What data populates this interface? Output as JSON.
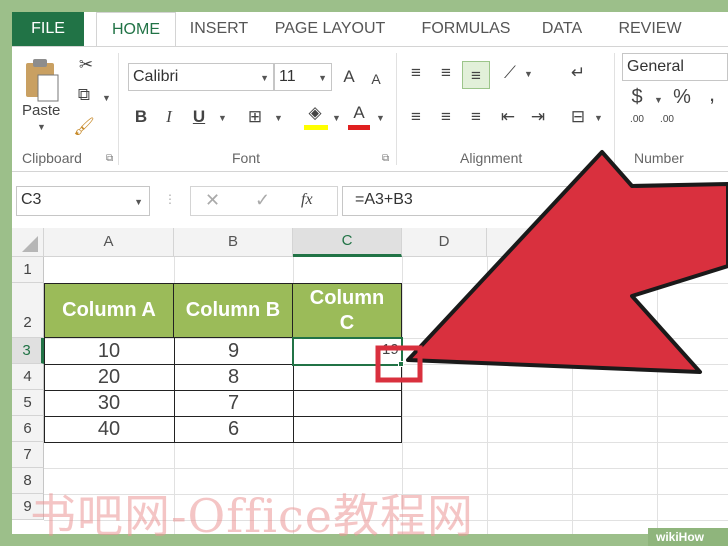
{
  "ribbon_tabs": [
    "FILE",
    "HOME",
    "INSERT",
    "PAGE LAYOUT",
    "FORMULAS",
    "DATA",
    "REVIEW"
  ],
  "clipboard": {
    "paste_label": "Paste",
    "group_label": "Clipboard"
  },
  "font": {
    "name": "Calibri",
    "size": "11",
    "group_label": "Font",
    "bold": "B",
    "italic": "I",
    "underline": "U",
    "grow": "A",
    "shrink": "A",
    "font_color": "A"
  },
  "alignment": {
    "group_label": "Alignment"
  },
  "number": {
    "format": "General",
    "currency": "$",
    "percent": "%",
    "group_label": "Number",
    "inc_decimal": ".00",
    "dec_decimal": ".00"
  },
  "formula_bar": {
    "name_box": "C3",
    "fx": "fx",
    "formula": "=A3+B3"
  },
  "columns": [
    "A",
    "B",
    "C",
    "D"
  ],
  "rows": [
    "1",
    "2",
    "3",
    "4",
    "5",
    "6",
    "7",
    "8",
    "9"
  ],
  "table": {
    "headers": [
      "Column A",
      "Column B",
      "Column C"
    ],
    "header_c_lines": [
      "Column",
      "C"
    ],
    "col_a": [
      "10",
      "20",
      "30",
      "40"
    ],
    "col_b": [
      "9",
      "8",
      "7",
      "6"
    ],
    "c3_partial": "19"
  },
  "colors": {
    "excel_green": "#217346",
    "header_fill": "#9bbb59",
    "arrow_red": "#d9303e",
    "highlight": "#e2f0d9"
  },
  "watermark": "书吧网-Office教程网",
  "wikihow": "wikiHow"
}
